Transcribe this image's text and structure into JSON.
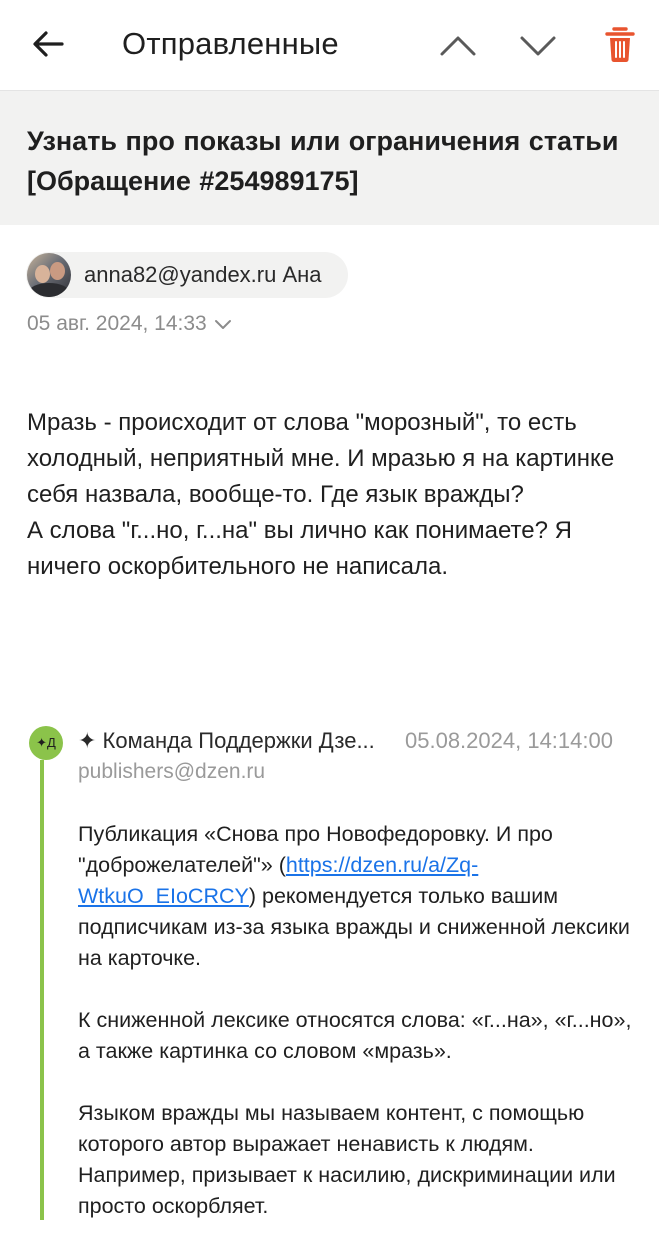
{
  "header": {
    "title": "Отправленные",
    "accent_color": "#e8542f"
  },
  "subject": "Узнать про показы или ограничения статьи [Обращение #254989175]",
  "sender": {
    "label": "anna82@yandex.ru Ана",
    "date": "05 авг. 2024, 14:33"
  },
  "message": {
    "para1": "Мразь - происходит от слова \"морозный\", то есть холодный, неприятный мне. И мразью я на картинке себя назвала, вообще-то. Где язык вражды?",
    "para2": "А слова \"г...но, г...на\" вы лично как понимаете? Я ничего оскорбительного не написала."
  },
  "quote": {
    "avatar_text": "✦Д",
    "from": "✦ Команда Поддержки Дзе...",
    "date": "05.08.2024, 14:14:00",
    "email": "publishers@dzen.ru",
    "accent_color": "#8bc34a",
    "p1_before": "Публикация «Снова про Новофедоровку. И про \"доброжелателей\"» (",
    "p1_link": "https://dzen.ru/a/Zq-WtkuO_EIoCRCY",
    "p1_after": ") рекомендуется только вашим подписчикам из-за языка вражды и сниженной лексики на карточке.",
    "p2": "К сниженной лексике относятся слова: «г...на», «г...но», а также картинка со словом «мразь».",
    "p3": "Языком вражды мы называем контент, с помощью которого автор выражает ненависть к людям. Например, призывает к насилию, дискриминации или просто оскорбляет."
  }
}
